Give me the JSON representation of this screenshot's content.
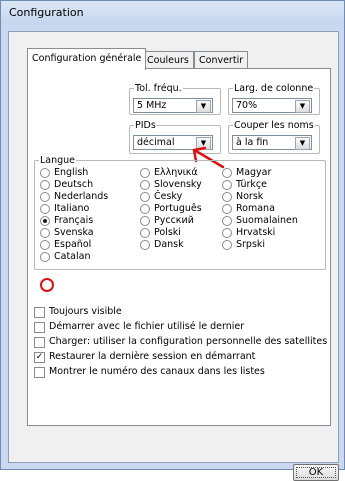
{
  "window": {
    "title": "Configuration"
  },
  "tabs": [
    {
      "label": "Configuration générale",
      "active": true
    },
    {
      "label": "Couleurs",
      "active": false
    },
    {
      "label": "Convertir",
      "active": false
    }
  ],
  "tol_frequ": {
    "label": "Tol. fréqu.",
    "value": "5 MHz"
  },
  "larg_colonne": {
    "label": "Larg. de colonne",
    "value": "70%"
  },
  "pids": {
    "label": "PIDs",
    "value": "décimal"
  },
  "couper_noms": {
    "label": "Couper les noms",
    "value": "à la fin"
  },
  "langue": {
    "label": "Langue",
    "col1": [
      "English",
      "Deutsch",
      "Nederlands",
      "Italiano",
      "Français",
      "Svenska",
      "Español",
      "Catalan"
    ],
    "col2": [
      "Ελληνικά",
      "Slovensky",
      "Česky",
      "Português",
      "Русский",
      "Polski",
      "Dansk"
    ],
    "col3": [
      "Magyar",
      "Türkçe",
      "Norsk",
      "Romana",
      "Suomalainen",
      "Hrvatski",
      "Srpski"
    ],
    "selected": "Français"
  },
  "options": [
    {
      "label": "Toujours visible",
      "checked": false
    },
    {
      "label": "Démarrer avec le fichier utilisé le dernier",
      "checked": false
    },
    {
      "label": "Charger: utiliser la configuration personnelle des satellites",
      "checked": false
    },
    {
      "label": "Restaurer la dernière session en démarrant",
      "checked": true
    },
    {
      "label": "Montrer le numéro des canaux dans les listes",
      "checked": false
    }
  ],
  "ok_button": "OK",
  "annotation_color": "#e01010"
}
